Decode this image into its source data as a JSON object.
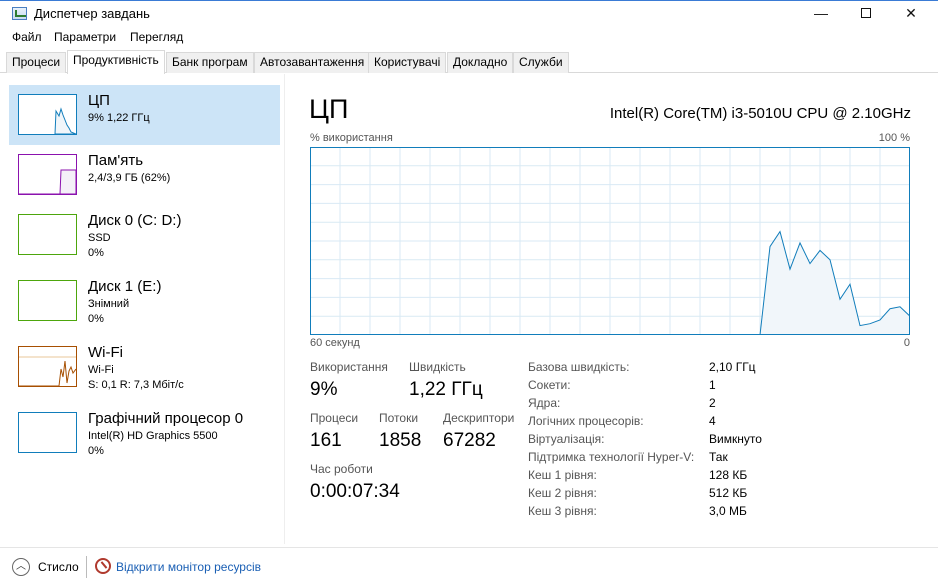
{
  "window": {
    "title": "Диспетчер завдань",
    "minimize": "—",
    "close": "✕"
  },
  "menu": [
    "Файл",
    "Параметри",
    "Перегляд"
  ],
  "tabs": [
    "Процеси",
    "Продуктивність",
    "Банк програм",
    "Автозавантаження",
    "Користувачі",
    "Докладно",
    "Служби"
  ],
  "sidebar": [
    {
      "title": "ЦП",
      "sub1": "9% 1,22 ГГц",
      "sub2": "",
      "sub3": ""
    },
    {
      "title": "Пам'ять",
      "sub1": "2,4/3,9 ГБ (62%)",
      "sub2": "",
      "sub3": ""
    },
    {
      "title": "Диск 0 (C: D:)",
      "sub1": "SSD",
      "sub2": "0%",
      "sub3": ""
    },
    {
      "title": "Диск 1 (E:)",
      "sub1": "Знімний",
      "sub2": "0%",
      "sub3": ""
    },
    {
      "title": "Wi-Fi",
      "sub1": "Wi-Fi",
      "sub2": "S: 0,1  R: 7,3 Мбіт/с",
      "sub3": ""
    },
    {
      "title": "Графічний процесор 0",
      "sub1": "Intel(R) HD Graphics 5500",
      "sub2": "0%",
      "sub3": ""
    }
  ],
  "colors": {
    "cpu": "#117dbb",
    "memory": "#8b12ae",
    "disk": "#4da60c",
    "wifi": "#a74f01",
    "gpu": "#117dbb",
    "graph_fill": "#f1f6fa",
    "grid": "#d9eaf4",
    "selected": "#cce4f7"
  },
  "main": {
    "heading": "ЦП",
    "model": "Intel(R) Core(TM) i3-5010U CPU @ 2.10GHz",
    "graph_label": "% використання",
    "graph_max": "100 %",
    "graph_time": "60 секунд",
    "graph_min": "0",
    "stats": {
      "usage_label": "Використання",
      "usage_value": "9%",
      "speed_label": "Швидкість",
      "speed_value": "1,22 ГГц",
      "processes_label": "Процеси",
      "processes_value": "161",
      "threads_label": "Потоки",
      "threads_value": "1858",
      "handles_label": "Дескриптори",
      "handles_value": "67282",
      "uptime_label": "Час роботи",
      "uptime_value": "0:00:07:34"
    },
    "specs": [
      {
        "key": "Базова швидкість:",
        "value": "2,10 ГГц"
      },
      {
        "key": "Сокети:",
        "value": "1"
      },
      {
        "key": "Ядра:",
        "value": "2"
      },
      {
        "key": "Логічних процесорів:",
        "value": "4"
      },
      {
        "key": "Віртуалізація:",
        "value": "Вимкнуто"
      },
      {
        "key": "Підтримка технології Hyper-V:",
        "value": "Так"
      },
      {
        "key": "Кеш 1 рівня:",
        "value": "128 КБ"
      },
      {
        "key": "Кеш 2 рівня:",
        "value": "512 КБ"
      },
      {
        "key": "Кеш 3 рівня:",
        "value": "3,0 МБ"
      }
    ]
  },
  "cpu_usage_history": [
    0,
    0,
    0,
    0,
    0,
    0,
    0,
    0,
    0,
    0,
    0,
    0,
    0,
    0,
    0,
    0,
    0,
    0,
    0,
    0,
    0,
    0,
    0,
    0,
    0,
    0,
    0,
    0,
    0,
    0,
    0,
    0,
    0,
    0,
    0,
    0,
    0,
    0,
    0,
    0,
    0,
    0,
    0,
    0,
    0,
    0,
    47,
    55,
    35,
    49,
    38,
    45,
    40,
    19,
    27,
    5,
    6,
    8,
    14,
    15,
    10
  ],
  "footer": {
    "fewer": "Стисло",
    "monitor": "Відкрити монітор ресурсів"
  }
}
